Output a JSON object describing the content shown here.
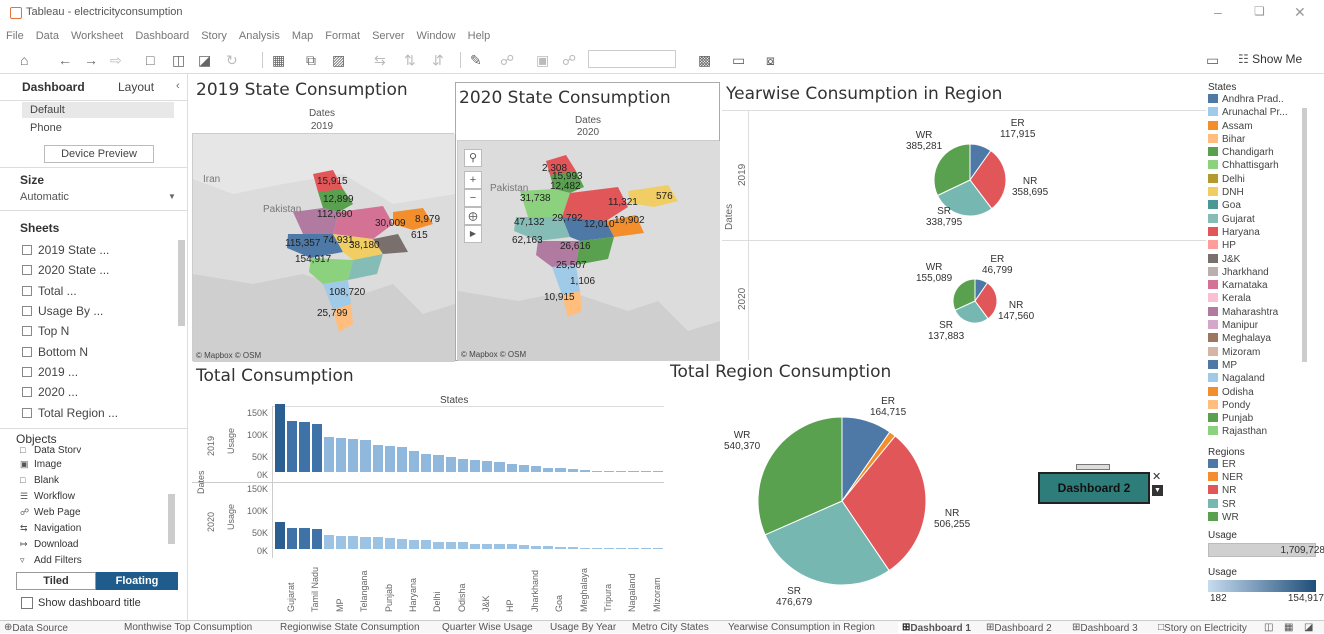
{
  "window": {
    "title": "Tableau - electricityconsumption"
  },
  "menu": [
    "File",
    "Data",
    "Worksheet",
    "Dashboard",
    "Story",
    "Analysis",
    "Map",
    "Format",
    "Server",
    "Window",
    "Help"
  ],
  "toolbar": {
    "show_me": "Show Me"
  },
  "left_pane": {
    "tabs": [
      "Dashboard",
      "Layout"
    ],
    "devices": [
      "Default",
      "Phone"
    ],
    "device_preview": "Device Preview",
    "size_title": "Size",
    "size_value": "Automatic",
    "sheets_title": "Sheets",
    "sheets": [
      "2019 State ...",
      "2020 State ...",
      "Total ...",
      "Usage By ...",
      "Top N",
      "Bottom N",
      "2019 ...",
      "2020 ...",
      "Total Region ..."
    ],
    "objects_title": "Objects",
    "objects": [
      "Data Story",
      "Image",
      "Blank",
      "Workflow",
      "Web Page",
      "Navigation",
      "Download",
      "Add Filters"
    ],
    "tiled": "Tiled",
    "floating": "Floating",
    "show_title": "Show dashboard title"
  },
  "dashboard": {
    "map2019": {
      "title": "2019 State Consumption",
      "sub1": "Dates",
      "sub2": "2019",
      "credit": "© Mapbox © OSM",
      "places": [
        "Iran",
        "Pakistan"
      ],
      "labels": [
        "15,915",
        "12,899",
        "112,690",
        "30,009",
        "8,979",
        "615",
        "115,357",
        "74,931",
        "38,180",
        "154,917",
        "108,720",
        "25,799"
      ]
    },
    "map2020": {
      "title": "2020 State Consumption",
      "sub1": "Dates",
      "sub2": "2020",
      "credit": "© Mapbox © OSM",
      "places": [
        "Pakistan"
      ],
      "labels": [
        "2,308",
        "15,993",
        "12,482",
        "31,738",
        "11,321",
        "576",
        "47,132",
        "29,792",
        "12,010",
        "19,902",
        "62,163",
        "26,616",
        "25,507",
        "1,106",
        "10,915"
      ]
    },
    "yearwise": {
      "title": "Yearwise Consumption in Region",
      "axis": "Dates",
      "years": [
        "2019",
        "2020"
      ],
      "pie2019": [
        [
          "ER",
          "117,915"
        ],
        [
          "NR",
          "358,695"
        ],
        [
          "SR",
          "338,795"
        ],
        [
          "WR",
          "385,281"
        ]
      ],
      "pie2020": [
        [
          "ER",
          "46,799"
        ],
        [
          "NR",
          "147,560"
        ],
        [
          "SR",
          "137,883"
        ],
        [
          "WR",
          "155,089"
        ]
      ]
    },
    "total": {
      "title": "Total Consumption",
      "header": "States",
      "axis": "Dates",
      "usage": "Usage",
      "years": [
        "2019",
        "2020"
      ],
      "ticks2019": [
        "150K",
        "100K",
        "50K",
        "0K"
      ],
      "ticks2020": [
        "150K",
        "100K",
        "50K",
        "0K"
      ],
      "xlabels": [
        "Gujarat",
        "Tamil Nadu",
        "MP",
        "Telangana",
        "Punjab",
        "Haryana",
        "Delhi",
        "Odisha",
        "J&K",
        "HP",
        "Jharkhand",
        "Goa",
        "Meghalaya",
        "Tripura",
        "Nagaland",
        "Mizoram"
      ]
    },
    "region": {
      "title": "Total Region Consumption",
      "labels": [
        [
          "ER",
          "164,715"
        ],
        [
          "NR",
          "506,255"
        ],
        [
          "SR",
          "476,679"
        ],
        [
          "WR",
          "540,370"
        ]
      ]
    },
    "floating_button": "Dashboard 2"
  },
  "chart_data": [
    {
      "type": "bar",
      "title": "Total Consumption",
      "ylabel": "Usage",
      "ylim": [
        0,
        150000
      ],
      "series": [
        {
          "name": "2019",
          "values": [
            154917,
            115357,
            112690,
            108720,
            80000,
            78000,
            74931,
            72000,
            62000,
            60000,
            56000,
            48000,
            40000,
            38180,
            33000,
            30009,
            27000,
            25799,
            22000,
            18000,
            15915,
            12899,
            10000,
            8979,
            7000,
            5000,
            3000,
            2000,
            1500,
            1000,
            800,
            615
          ]
        },
        {
          "name": "2020",
          "values": [
            62163,
            47132,
            47000,
            46000,
            31738,
            30000,
            29792,
            28000,
            26616,
            25507,
            22000,
            20000,
            19902,
            17000,
            15993,
            15000,
            12482,
            12010,
            11321,
            10915,
            9000,
            7000,
            6000,
            5000,
            4000,
            2308,
            2000,
            1600,
            1106,
            900,
            700,
            576
          ]
        }
      ]
    },
    {
      "type": "pie",
      "title": "Total Region Consumption",
      "categories": [
        "ER",
        "NER",
        "NR",
        "SR",
        "WR"
      ],
      "values": [
        164715,
        22000,
        506255,
        476679,
        540370
      ]
    },
    {
      "type": "pie",
      "title": "Yearwise Consumption in Region 2019",
      "categories": [
        "ER",
        "NER",
        "NR",
        "SR",
        "WR"
      ],
      "values": [
        117915,
        0,
        358695,
        338795,
        385281
      ]
    },
    {
      "type": "pie",
      "title": "Yearwise Consumption in Region 2020",
      "categories": [
        "ER",
        "NER",
        "NR",
        "SR",
        "WR"
      ],
      "values": [
        46799,
        0,
        147560,
        137883,
        155089
      ]
    }
  ],
  "legend": {
    "states_title": "States",
    "states": [
      [
        "Andhra Prad..",
        "#4e79a7"
      ],
      [
        "Arunachal Pr...",
        "#a0cbe8"
      ],
      [
        "Assam",
        "#f28e2b"
      ],
      [
        "Bihar",
        "#ffbe7d"
      ],
      [
        "Chandigarh",
        "#59a14f"
      ],
      [
        "Chhattisgarh",
        "#8cd17d"
      ],
      [
        "Delhi",
        "#b6992d"
      ],
      [
        "DNH",
        "#f1ce63"
      ],
      [
        "Goa",
        "#499894"
      ],
      [
        "Gujarat",
        "#86bcb6"
      ],
      [
        "Haryana",
        "#e15759"
      ],
      [
        "HP",
        "#ff9d9a"
      ],
      [
        "J&K",
        "#79706e"
      ],
      [
        "Jharkhand",
        "#bab0ac"
      ],
      [
        "Karnataka",
        "#d37295"
      ],
      [
        "Kerala",
        "#fabfd2"
      ],
      [
        "Maharashtra",
        "#b07aa1"
      ],
      [
        "Manipur",
        "#d4a6c8"
      ],
      [
        "Meghalaya",
        "#9d7660"
      ],
      [
        "Mizoram",
        "#d7b5a6"
      ],
      [
        "MP",
        "#4e79a7"
      ],
      [
        "Nagaland",
        "#a0cbe8"
      ],
      [
        "Odisha",
        "#f28e2b"
      ],
      [
        "Pondy",
        "#ffbe7d"
      ],
      [
        "Punjab",
        "#59a14f"
      ],
      [
        "Rajasthan",
        "#8cd17d"
      ]
    ],
    "regions_title": "Regions",
    "regions": [
      [
        "ER",
        "#4e79a7"
      ],
      [
        "NER",
        "#f28e2b"
      ],
      [
        "NR",
        "#e15759"
      ],
      [
        "SR",
        "#76b7b2"
      ],
      [
        "WR",
        "#59a14f"
      ]
    ],
    "usage_title": "Usage",
    "usage_value": "1,709,728",
    "usage2_title": "Usage",
    "usage2_min": "182",
    "usage2_max": "154,917"
  },
  "bottom_tabs": [
    "Data Source",
    "Monthwise Top Consumption",
    "Regionwise State Consumption",
    "Quarter Wise Usage",
    "Usage By Year",
    "Metro City States",
    "Yearwise Consumption in Region",
    "Dashboard 1",
    "Dashboard 2",
    "Dashboard 3",
    "Story on Electricity"
  ]
}
